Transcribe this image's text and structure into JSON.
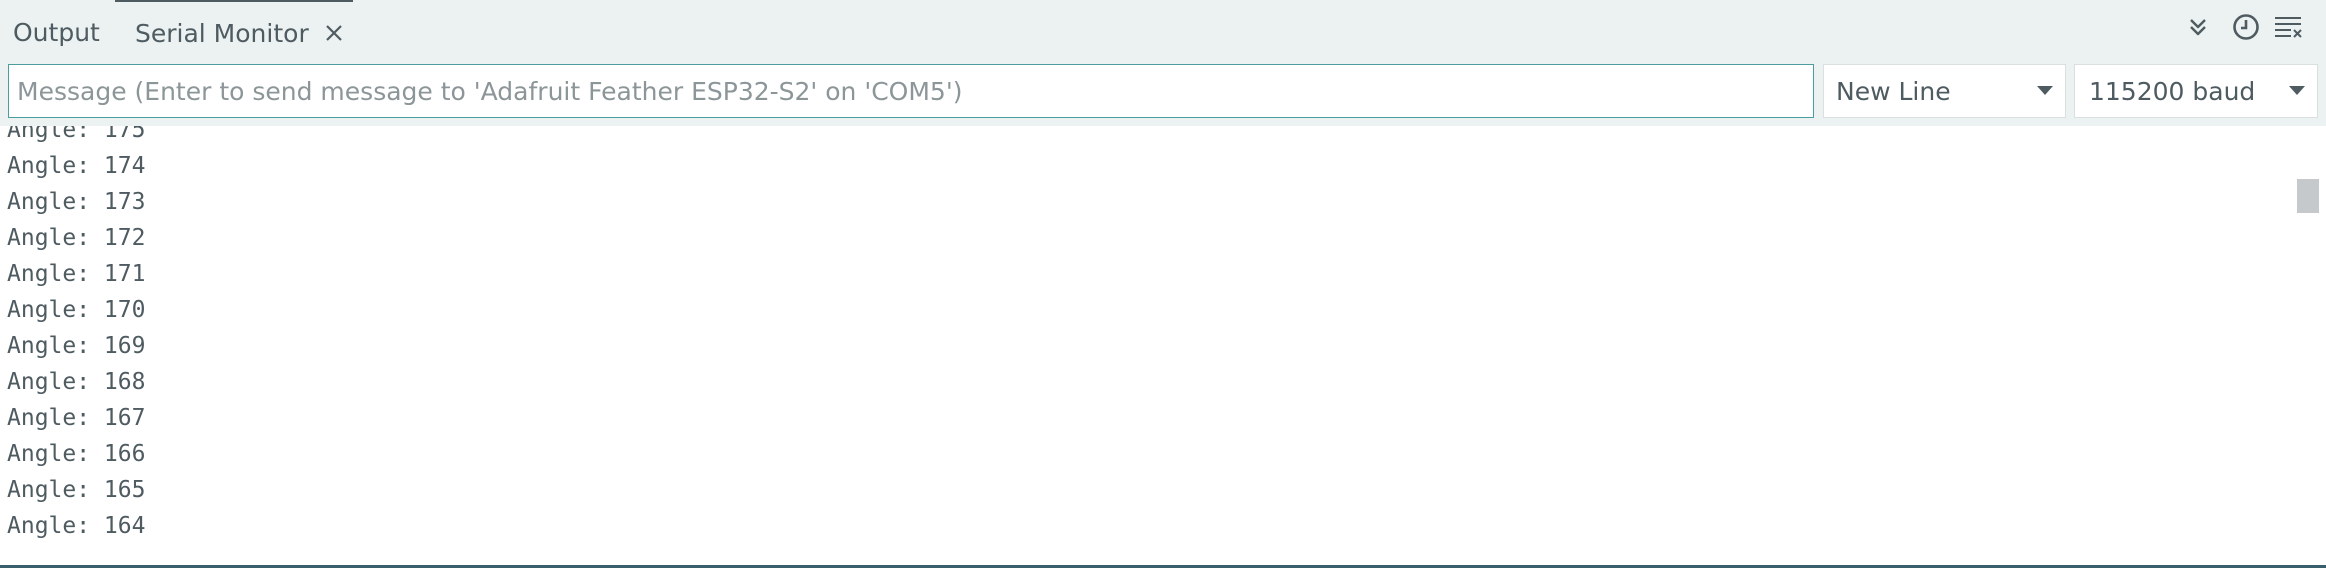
{
  "tabs": {
    "output_label": "Output",
    "serial_label": "Serial Monitor"
  },
  "toolbar": {
    "icons": [
      "toggle-autoscroll-icon",
      "toggle-timestamp-icon",
      "clear-output-icon"
    ]
  },
  "message": {
    "value": "",
    "placeholder": "Message (Enter to send message to 'Adafruit Feather ESP32-S2' on 'COM5')"
  },
  "line_ending": {
    "selected": "New Line"
  },
  "baud_rate": {
    "selected": "115200 baud"
  },
  "log": {
    "lines": [
      "Angle: 175",
      "Angle: 174",
      "Angle: 173",
      "Angle: 172",
      "Angle: 171",
      "Angle: 170",
      "Angle: 169",
      "Angle: 168",
      "Angle: 167",
      "Angle: 166",
      "Angle: 165",
      "Angle: 164"
    ]
  },
  "colors": {
    "toolbar_bg": "#ecf1f1",
    "text": "#4e5b61",
    "focus_border": "#4c9e9e",
    "bottom_border": "#3a5f6c"
  }
}
